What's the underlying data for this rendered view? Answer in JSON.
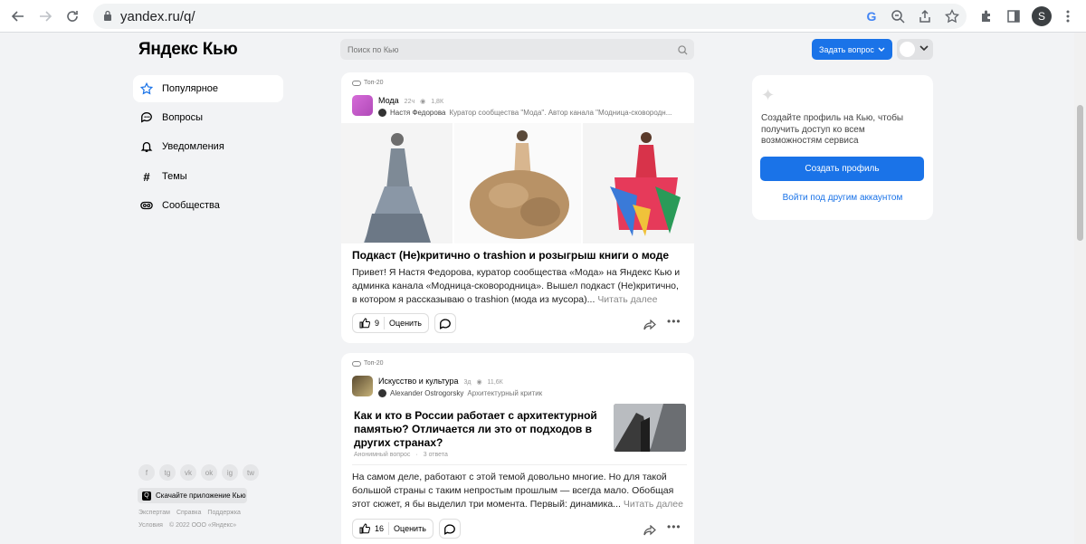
{
  "browser": {
    "url": "yandex.ru/q/",
    "profile_letter": "S"
  },
  "header": {
    "logo": "Яндекс Кью",
    "search_placeholder": "Поиск по Кью",
    "ask_button": "Задать вопрос"
  },
  "sidebar": {
    "items": [
      {
        "label": "Популярное",
        "icon": "star-icon"
      },
      {
        "label": "Вопросы",
        "icon": "chat-icon"
      },
      {
        "label": "Уведомления",
        "icon": "bell-icon"
      },
      {
        "label": "Темы",
        "icon": "hash-icon"
      },
      {
        "label": "Сообщества",
        "icon": "community-icon"
      }
    ],
    "socials": [
      "f",
      "tg",
      "vk",
      "ok",
      "ig",
      "tw"
    ],
    "app_button": "Скачайте приложение Кью",
    "footer_line1": [
      "Экспертам",
      "Справка",
      "Поддержка"
    ],
    "footer_line2": [
      "Условия",
      "© 2022 ООО «Яндекс»"
    ]
  },
  "feed": {
    "post1": {
      "badge": "Топ-20",
      "community": "Мода",
      "age": "22ч",
      "views": "1,8К",
      "author": "Настя Федорова",
      "author_role": "Куратор сообщества \"Мода\". Автор канала \"Модница-сковородн...",
      "title": "Подкаст (Не)критично о trashion и розыгрыш книги о моде",
      "text": "Привет! Я Настя Федорова, куратор сообщества «Мода» на Яндекс Кью и админка канала «Модница-сковородница». Вышел подкаст (Не)критично, в котором я рассказываю о trashion (мода из мусора)...",
      "read_more": "Читать далее",
      "likes": "9",
      "rate_label": "Оценить"
    },
    "post2": {
      "badge": "Топ-20",
      "community": "Искусство и культура",
      "age": "3д",
      "views": "11,6К",
      "author": "Alexander Ostrogorsky",
      "author_role": "Архитектурный критик",
      "question": "Как и кто в России работает с архитектурной памятью? Отличается ли это от подходов в других странах?",
      "q_author": "Анонимный вопрос",
      "q_answers": "3 ответа",
      "text": "На самом деле, работают с этой темой довольно многие. Но для такой большой страны с таким непростым прошлым — всегда мало.  Обобщая этот сюжет, я бы выделил три момента. Первый: динамика...",
      "read_more": "Читать далее",
      "likes": "16",
      "rate_label": "Оценить"
    }
  },
  "profile_panel": {
    "text": "Создайте профиль на Кью, чтобы получить доступ ко всем возможностям сервиса",
    "create_button": "Создать профиль",
    "other_account": "Войти под другим аккаунтом"
  },
  "colors": {
    "accent": "#1a73e8",
    "background": "#f2f3f5"
  }
}
